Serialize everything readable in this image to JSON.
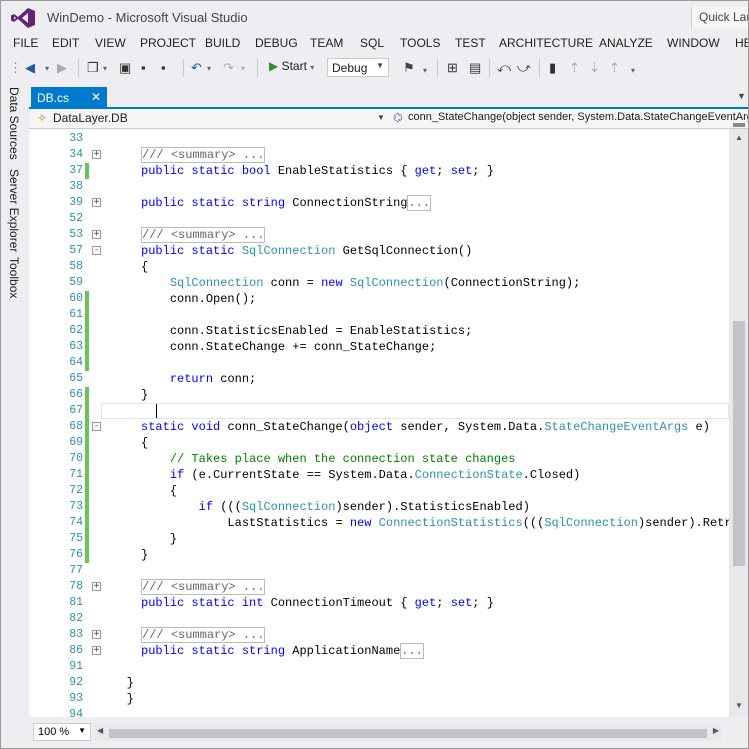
{
  "window": {
    "title": "WinDemo - Microsoft Visual Studio",
    "quick_launch": "Quick Launch"
  },
  "menu": [
    "FILE",
    "EDIT",
    "VIEW",
    "PROJECT",
    "BUILD",
    "DEBUG",
    "TEAM",
    "SQL",
    "TOOLS",
    "TEST",
    "ARCHITECTURE",
    "ANALYZE",
    "WINDOW",
    "HELP"
  ],
  "toolbar": {
    "start_label": "Start",
    "config_value": "Debug"
  },
  "side_tabs": [
    "Data Sources",
    "Server Explorer",
    "Toolbox"
  ],
  "document_tab": {
    "name": "DB.cs",
    "close": "✕"
  },
  "navigation": {
    "type_selector": "DataLayer.DB",
    "member_selector": "conn_StateChange(object sender, System.Data.StateChangeEventArgs e)"
  },
  "editor": {
    "lines": [
      {
        "n": "33",
        "fold": "",
        "chg": false,
        "code": []
      },
      {
        "n": "34",
        "fold": "+",
        "chg": false,
        "code": [
          [
            "box-dc",
            "/// <summary> ..."
          ]
        ]
      },
      {
        "n": "37",
        "fold": "",
        "chg": true,
        "code": [
          [
            "kw",
            "public static bool "
          ],
          [
            "",
            "EnableStatistics { "
          ],
          [
            "kw",
            "get"
          ],
          [
            "",
            "; "
          ],
          [
            "kw",
            "set"
          ],
          [
            "",
            "; }"
          ]
        ]
      },
      {
        "n": "38",
        "fold": "",
        "chg": false,
        "code": []
      },
      {
        "n": "39",
        "fold": "+",
        "chg": false,
        "code": [
          [
            "kw",
            "public static string "
          ],
          [
            "",
            "ConnectionString"
          ],
          [
            "box",
            "..."
          ]
        ]
      },
      {
        "n": "52",
        "fold": "",
        "chg": false,
        "code": []
      },
      {
        "n": "53",
        "fold": "+",
        "chg": false,
        "code": [
          [
            "box-dc",
            "/// <summary> ..."
          ]
        ]
      },
      {
        "n": "57",
        "fold": "-",
        "chg": false,
        "code": [
          [
            "kw",
            "public static "
          ],
          [
            "ty",
            "SqlConnection"
          ],
          [
            "",
            " GetSqlConnection()"
          ]
        ]
      },
      {
        "n": "58",
        "fold": "",
        "chg": false,
        "code": [
          [
            "",
            "{"
          ]
        ]
      },
      {
        "n": "59",
        "fold": "",
        "chg": false,
        "code": [
          [
            "",
            "    "
          ],
          [
            "ty",
            "SqlConnection"
          ],
          [
            "",
            " conn = "
          ],
          [
            "kw",
            "new "
          ],
          [
            "ty",
            "SqlConnection"
          ],
          [
            "",
            "(ConnectionString);"
          ]
        ]
      },
      {
        "n": "60",
        "fold": "",
        "chg": true,
        "code": [
          [
            "",
            "    conn.Open();"
          ]
        ]
      },
      {
        "n": "61",
        "fold": "",
        "chg": true,
        "code": []
      },
      {
        "n": "62",
        "fold": "",
        "chg": true,
        "code": [
          [
            "",
            "    conn.StatisticsEnabled = EnableStatistics;"
          ]
        ]
      },
      {
        "n": "63",
        "fold": "",
        "chg": true,
        "code": [
          [
            "",
            "    conn.StateChange += conn_StateChange;"
          ]
        ]
      },
      {
        "n": "64",
        "fold": "",
        "chg": true,
        "code": []
      },
      {
        "n": "65",
        "fold": "",
        "chg": false,
        "code": [
          [
            "",
            "    "
          ],
          [
            "kw",
            "return"
          ],
          [
            "",
            " conn;"
          ]
        ]
      },
      {
        "n": "66",
        "fold": "",
        "chg": true,
        "code": [
          [
            "",
            "}"
          ]
        ]
      },
      {
        "n": "67",
        "fold": "",
        "chg": true,
        "code": [],
        "current": true
      },
      {
        "n": "68",
        "fold": "-",
        "chg": true,
        "code": [
          [
            "kw",
            "static void "
          ],
          [
            "",
            "conn_StateChange("
          ],
          [
            "kw",
            "object"
          ],
          [
            "",
            " sender, System.Data."
          ],
          [
            "ty",
            "StateChangeEventArgs"
          ],
          [
            "",
            " e)"
          ]
        ]
      },
      {
        "n": "69",
        "fold": "",
        "chg": true,
        "code": [
          [
            "",
            "{"
          ]
        ]
      },
      {
        "n": "70",
        "fold": "",
        "chg": true,
        "code": [
          [
            "",
            "    "
          ],
          [
            "cm",
            "// Takes place when the connection state changes"
          ]
        ]
      },
      {
        "n": "71",
        "fold": "",
        "chg": true,
        "code": [
          [
            "",
            "    "
          ],
          [
            "kw",
            "if"
          ],
          [
            "",
            " (e.CurrentState == System.Data."
          ],
          [
            "ty",
            "ConnectionState"
          ],
          [
            "",
            ".Closed)"
          ]
        ]
      },
      {
        "n": "72",
        "fold": "",
        "chg": true,
        "code": [
          [
            "",
            "    {"
          ]
        ]
      },
      {
        "n": "73",
        "fold": "",
        "chg": true,
        "code": [
          [
            "",
            "        "
          ],
          [
            "kw",
            "if"
          ],
          [
            "",
            " ((("
          ],
          [
            "ty",
            "SqlConnection"
          ],
          [
            "",
            ")sender).StatisticsEnabled)"
          ]
        ]
      },
      {
        "n": "74",
        "fold": "",
        "chg": true,
        "code": [
          [
            "",
            "            LastStatistics = "
          ],
          [
            "kw",
            "new "
          ],
          [
            "ty",
            "ConnectionStatistics"
          ],
          [
            "",
            "((("
          ],
          [
            "ty",
            "SqlConnection"
          ],
          [
            "",
            ")sender).RetrieveStatistics());"
          ]
        ]
      },
      {
        "n": "75",
        "fold": "",
        "chg": true,
        "code": [
          [
            "",
            "    }"
          ]
        ]
      },
      {
        "n": "76",
        "fold": "",
        "chg": true,
        "code": [
          [
            "",
            "}"
          ]
        ]
      },
      {
        "n": "77",
        "fold": "",
        "chg": false,
        "code": []
      },
      {
        "n": "78",
        "fold": "+",
        "chg": false,
        "code": [
          [
            "box-dc",
            "/// <summary> ..."
          ]
        ]
      },
      {
        "n": "81",
        "fold": "",
        "chg": false,
        "code": [
          [
            "kw",
            "public static int "
          ],
          [
            "",
            "ConnectionTimeout { "
          ],
          [
            "kw",
            "get"
          ],
          [
            "",
            "; "
          ],
          [
            "kw",
            "set"
          ],
          [
            "",
            "; }"
          ]
        ]
      },
      {
        "n": "82",
        "fold": "",
        "chg": false,
        "code": []
      },
      {
        "n": "83",
        "fold": "+",
        "chg": false,
        "code": [
          [
            "box-dc",
            "/// <summary> ..."
          ]
        ]
      },
      {
        "n": "86",
        "fold": "+",
        "chg": false,
        "code": [
          [
            "kw",
            "public static string "
          ],
          [
            "",
            "ApplicationName"
          ],
          [
            "box",
            "..."
          ]
        ]
      },
      {
        "n": "91",
        "fold": "",
        "chg": false,
        "code": []
      },
      {
        "n": "92",
        "fold": "",
        "chg": false,
        "code": [
          [
            "",
            "}"
          ]
        ],
        "indent": -1
      },
      {
        "n": "93",
        "fold": "",
        "chg": false,
        "code": [
          [
            "",
            "}"
          ]
        ],
        "indent": -2
      },
      {
        "n": "94",
        "fold": "",
        "chg": false,
        "code": []
      }
    ]
  },
  "status": {
    "zoom": "100 %"
  },
  "colors": {
    "accent": "#007acc",
    "keyword": "#0000ff",
    "type": "#2b91af",
    "comment": "#008000",
    "changed_margin": "#6ac259"
  }
}
